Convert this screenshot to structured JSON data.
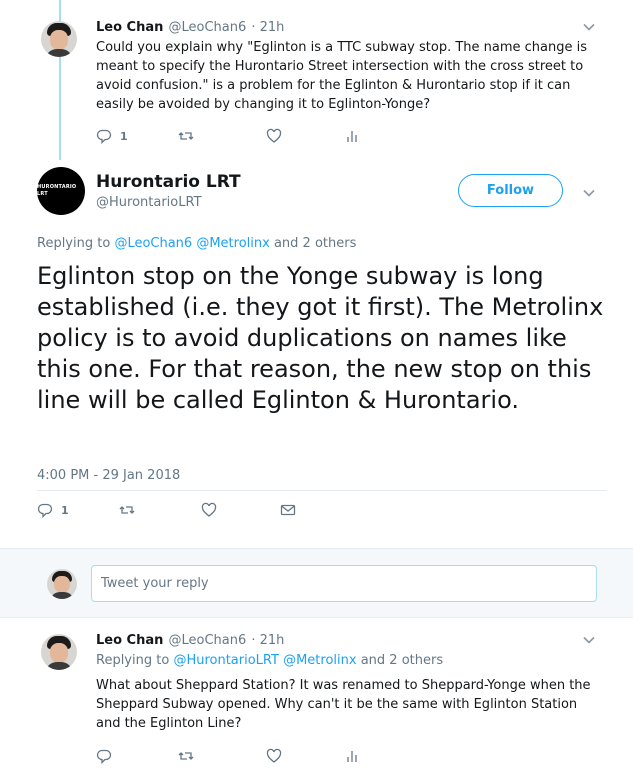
{
  "tweet1": {
    "name": "Leo Chan",
    "handle": "@LeoChan6",
    "time": "· 21h",
    "text": "Could you explain why \"Eglinton is a TTC subway stop. The name change is meant to specify the Hurontario Street intersection with the cross street to avoid confusion.\" is a problem for the Eglinton & Hurontario stop if it can easily be avoided by changing it to Eglinton-Yonge?",
    "reply_count": "1"
  },
  "main": {
    "name": "Hurontario LRT",
    "handle": "@HurontarioLRT",
    "avatar_text": "HURONTARIO LRT",
    "follow_label": "Follow",
    "replying_prefix": "Replying to",
    "replying_to": "@LeoChan6 @Metrolinx",
    "replying_suffix": "and 2 others",
    "text": "Eglinton stop on the Yonge subway is long established (i.e. they got it first). The Metrolinx policy is to avoid duplications on names like this one. For that reason, the new stop on this line will be called Eglinton & Hurontario.",
    "timestamp": "4:00 PM - 29 Jan 2018",
    "reply_count": "1"
  },
  "composer": {
    "placeholder": "Tweet your reply"
  },
  "tweet2": {
    "name": "Leo Chan",
    "handle": "@LeoChan6",
    "time": "· 21h",
    "replying_prefix": "Replying to",
    "replying_to": "@HurontarioLRT @Metrolinx",
    "replying_suffix": "and 2 others",
    "text": "What about Sheppard Station? It was renamed to Sheppard-Yonge when the Sheppard Subway opened. Why can't it be the same with Eglinton Station and the Eglinton Line?"
  },
  "colors": {
    "accent": "#1da1f2",
    "thread_line": "#a8dcf6",
    "muted": "#657786",
    "text": "#14171a"
  },
  "icons": [
    "reply-icon",
    "retweet-icon",
    "like-icon",
    "analytics-icon",
    "message-icon",
    "chevron-down-icon"
  ]
}
